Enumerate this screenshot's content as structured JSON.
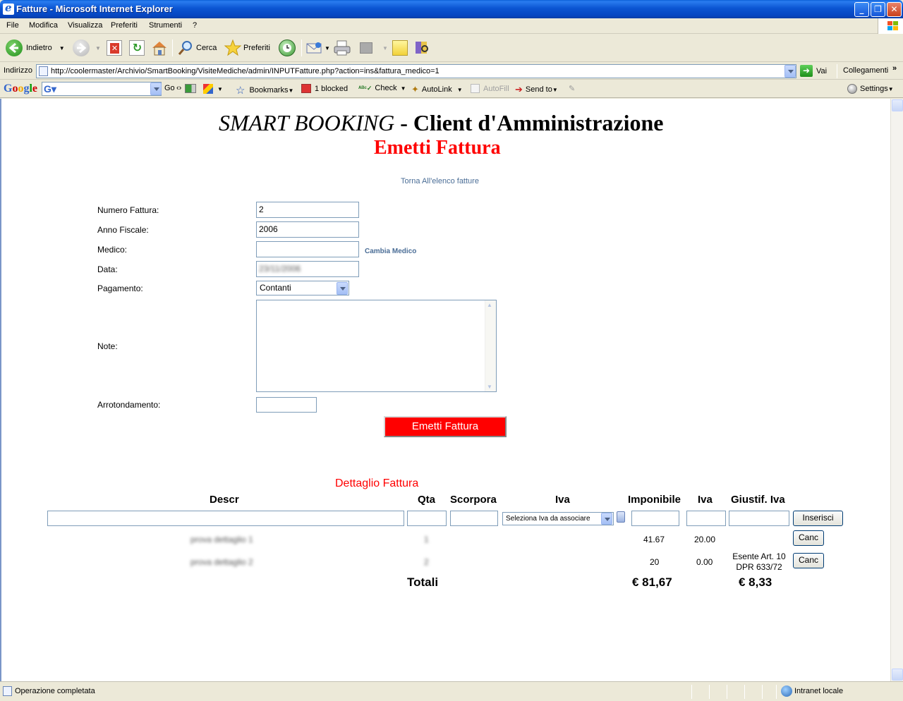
{
  "window": {
    "title": "Fatture - Microsoft Internet Explorer"
  },
  "menu": [
    "File",
    "Modifica",
    "Visualizza",
    "Preferiti",
    "Strumenti",
    "?"
  ],
  "toolbar": {
    "back": "Indietro",
    "search": "Cerca",
    "favorites": "Preferiti"
  },
  "address": {
    "label": "Indirizzo",
    "url": "http://coolermaster/Archivio/SmartBooking/VisiteMediche/admin/INPUTFatture.php?action=ins&fattura_medico=1",
    "go": "Vai",
    "links": "Collegamenti"
  },
  "google": {
    "logo": "Google",
    "go": "Go",
    "bookmarks": "Bookmarks",
    "blocked": "1 blocked",
    "check": "Check",
    "autolink": "AutoLink",
    "autofill": "AutoFill",
    "sendto": "Send to",
    "settings": "Settings"
  },
  "page": {
    "title_italic": "SMART BOOKING",
    "title_rest": " - Client d'Amministrazione",
    "subtitle": "Emetti Fattura",
    "back_link": "Torna All'elenco fatture"
  },
  "form": {
    "numero_label": "Numero Fattura:",
    "numero_value": "2",
    "anno_label": "Anno Fiscale:",
    "anno_value": "2006",
    "medico_label": "Medico:",
    "medico_value": "",
    "cambia_medico": "Cambia Medico",
    "data_label": "Data:",
    "data_value": "23/11/2006",
    "pagamento_label": "Pagamento:",
    "pagamento_value": "Contanti",
    "note_label": "Note:",
    "note_value": "",
    "arrotondamento_label": "Arrotondamento:",
    "arrotondamento_value": "",
    "submit": "Emetti Fattura"
  },
  "detail": {
    "title": "Dettaglio Fattura",
    "headers": {
      "descr": "Descr",
      "qta": "Qta",
      "scorpora": "Scorpora",
      "iva": "Iva",
      "imponibile": "Imponibile",
      "iva2": "Iva",
      "giustif": "Giustif. Iva"
    },
    "iva_select": "Seleziona Iva da associare",
    "insert_button": "Inserisci",
    "rows": [
      {
        "descr": "prova dettaglio 1",
        "qta": "1",
        "imponibile": "41.67",
        "iva": "20.00",
        "giustif_1": "",
        "giustif_2": "",
        "cancel": "Canc"
      },
      {
        "descr": "prova dettaglio 2",
        "qta": "2",
        "imponibile": "20",
        "iva": "0.00",
        "giustif_1": "Esente Art. 10",
        "giustif_2": "DPR 633/72",
        "cancel": "Canc"
      }
    ],
    "totals_label": "Totali",
    "total_imponibile": "€ 81,67",
    "total_iva": "€ 8,33"
  },
  "status": {
    "text": "Operazione completata",
    "zone": "Intranet locale"
  },
  "colors": {
    "accent_red": "#ff0000",
    "link": "#4a6d96",
    "title_bar": "#0b55d2"
  }
}
